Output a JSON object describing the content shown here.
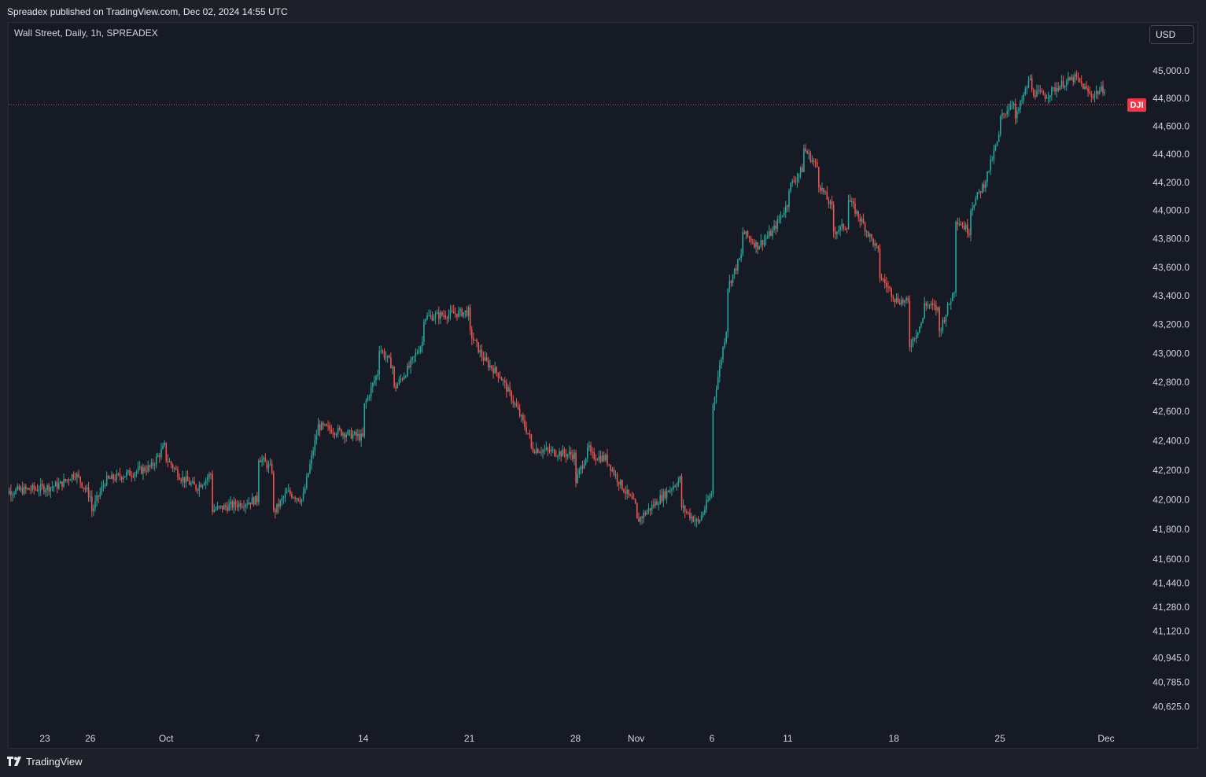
{
  "header": {
    "published": "Spreadex published on TradingView.com, Dec 02, 2024 14:55 UTC"
  },
  "legend": {
    "symbol": "Wall Street, Daily, 1h, SPREADEX"
  },
  "currency_button": {
    "label": "USD"
  },
  "footer": {
    "brand": "TradingView"
  },
  "colors": {
    "up": "#26a69a",
    "down": "#ef5350",
    "background": "#161a25",
    "priceline": "#ef5350"
  },
  "chart_data": {
    "type": "candlestick",
    "title": "Wall Street, Daily, 1h, SPREADEX",
    "y_axis": {
      "side": "right",
      "scale": "log",
      "range": [
        40500,
        45150
      ],
      "ticks": [
        45000,
        44800,
        44600,
        44400,
        44200,
        44000,
        43800,
        43600,
        43400,
        43200,
        43000,
        42800,
        42600,
        42400,
        42200,
        42000,
        41800,
        41600,
        41440,
        41280,
        41120,
        40945,
        40785,
        40625
      ],
      "tick_labels": [
        "45,000.0",
        "44,800.0",
        "44,600.0",
        "44,400.0",
        "44,200.0",
        "44,000.0",
        "43,800.0",
        "43,600.0",
        "43,400.0",
        "43,200.0",
        "43,000.0",
        "42,800.0",
        "42,600.0",
        "42,400.0",
        "42,200.0",
        "42,000.0",
        "41,800.0",
        "41,600.0",
        "41,440.0",
        "41,280.0",
        "41,120.0",
        "40,945.0",
        "40,785.0",
        "40,625.0"
      ]
    },
    "x_axis": {
      "labels": [
        "23",
        "26",
        "Oct",
        "7",
        "14",
        "21",
        "28",
        "Nov",
        "6",
        "11",
        "18",
        "25",
        "Dec"
      ],
      "label_dates": [
        "2024-09-23",
        "2024-09-26",
        "2024-10-01",
        "2024-10-07",
        "2024-10-14",
        "2024-10-21",
        "2024-10-28",
        "2024-11-01",
        "2024-11-06",
        "2024-11-11",
        "2024-11-18",
        "2024-11-25",
        "2024-12-02"
      ]
    },
    "price_label": {
      "text": "DJI",
      "value": 44755
    },
    "grid": false,
    "path": [
      [
        "2024-09-20",
        41780
      ],
      [
        "2024-09-20",
        42050
      ],
      [
        "2024-09-23",
        42080
      ],
      [
        "2024-09-24",
        42100
      ],
      [
        "2024-09-25",
        42180
      ],
      [
        "2024-09-26",
        42020
      ],
      [
        "2024-09-26",
        41900
      ],
      [
        "2024-09-27",
        42130
      ],
      [
        "2024-09-30",
        42220
      ],
      [
        "2024-10-01",
        42380
      ],
      [
        "2024-10-01",
        42280
      ],
      [
        "2024-10-02",
        42150
      ],
      [
        "2024-10-03",
        42080
      ],
      [
        "2024-10-04",
        42180
      ],
      [
        "2024-10-04",
        41930
      ],
      [
        "2024-10-07",
        42000
      ],
      [
        "2024-10-07",
        42300
      ],
      [
        "2024-10-08",
        42200
      ],
      [
        "2024-10-08",
        41900
      ],
      [
        "2024-10-09",
        42050
      ],
      [
        "2024-10-10",
        42000
      ],
      [
        "2024-10-11",
        42480
      ],
      [
        "2024-10-11",
        42500
      ],
      [
        "2024-10-14",
        42420
      ],
      [
        "2024-10-14",
        42620
      ],
      [
        "2024-10-15",
        42880
      ],
      [
        "2024-10-15",
        43050
      ],
      [
        "2024-10-16",
        42900
      ],
      [
        "2024-10-16",
        42750
      ],
      [
        "2024-10-17",
        42900
      ],
      [
        "2024-10-18",
        43100
      ],
      [
        "2024-10-18",
        43250
      ],
      [
        "2024-10-21",
        43290
      ],
      [
        "2024-10-21",
        43150
      ],
      [
        "2024-10-22",
        42950
      ],
      [
        "2024-10-23",
        42850
      ],
      [
        "2024-10-24",
        42650
      ],
      [
        "2024-10-25",
        42420
      ],
      [
        "2024-10-25",
        42350
      ],
      [
        "2024-10-28",
        42300
      ],
      [
        "2024-10-28",
        42120
      ],
      [
        "2024-10-29",
        42380
      ],
      [
        "2024-10-29",
        42300
      ],
      [
        "2024-10-30",
        42280
      ],
      [
        "2024-10-31",
        42100
      ],
      [
        "2024-11-01",
        41950
      ],
      [
        "2024-11-01",
        41850
      ],
      [
        "2024-11-04",
        42150
      ],
      [
        "2024-11-04",
        41950
      ],
      [
        "2024-11-05",
        41850
      ],
      [
        "2024-11-05",
        41820
      ],
      [
        "2024-11-06",
        42050
      ],
      [
        "2024-11-06",
        42600
      ],
      [
        "2024-11-07",
        43200
      ],
      [
        "2024-11-07",
        43450
      ],
      [
        "2024-11-08",
        43700
      ],
      [
        "2024-11-08",
        43850
      ],
      [
        "2024-11-09",
        43750
      ],
      [
        "2024-11-10",
        43850
      ],
      [
        "2024-11-11",
        44050
      ],
      [
        "2024-11-11",
        44150
      ],
      [
        "2024-11-12",
        44300
      ],
      [
        "2024-11-12",
        44450
      ],
      [
        "2024-11-13",
        44300
      ],
      [
        "2024-11-13",
        44200
      ],
      [
        "2024-11-14",
        44000
      ],
      [
        "2024-11-14",
        43850
      ],
      [
        "2024-11-15",
        43900
      ],
      [
        "2024-11-15",
        44080
      ],
      [
        "2024-11-16",
        43900
      ],
      [
        "2024-11-17",
        43700
      ],
      [
        "2024-11-17",
        43550
      ],
      [
        "2024-11-18",
        43400
      ],
      [
        "2024-11-18",
        43380
      ],
      [
        "2024-11-19",
        43350
      ],
      [
        "2024-11-19",
        43050
      ],
      [
        "2024-11-20",
        43250
      ],
      [
        "2024-11-20",
        43350
      ],
      [
        "2024-11-21",
        43300
      ],
      [
        "2024-11-21",
        43150
      ],
      [
        "2024-11-22",
        43450
      ],
      [
        "2024-11-22",
        43950
      ],
      [
        "2024-11-23",
        43850
      ],
      [
        "2024-11-23",
        44000
      ],
      [
        "2024-11-24",
        44200
      ],
      [
        "2024-11-25",
        44550
      ],
      [
        "2024-11-25",
        44650
      ],
      [
        "2024-11-26",
        44800
      ],
      [
        "2024-11-26",
        44650
      ],
      [
        "2024-11-27",
        44950
      ],
      [
        "2024-11-27",
        44850
      ],
      [
        "2024-11-28",
        44820
      ],
      [
        "2024-11-29",
        44900
      ],
      [
        "2024-11-30",
        44950
      ],
      [
        "2024-12-01",
        44820
      ],
      [
        "2024-12-02",
        44880
      ],
      [
        "2024-12-02",
        44930
      ]
    ]
  }
}
